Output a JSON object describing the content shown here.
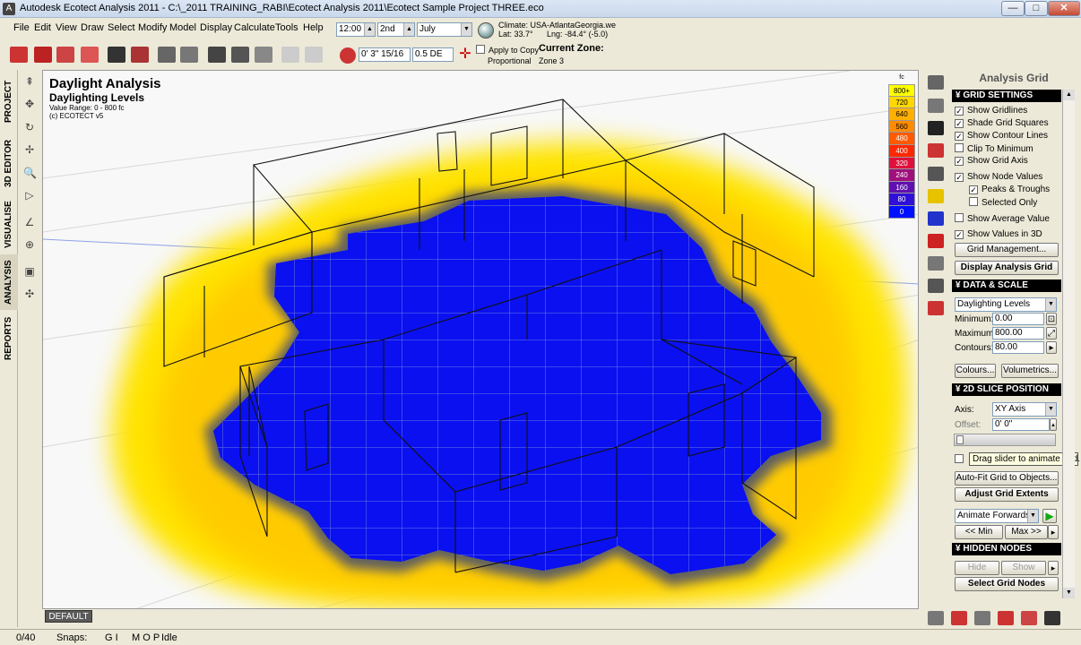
{
  "window": {
    "title": "Autodesk Ecotect Analysis 2011 - C:\\_2011 TRAINING_RABI\\Ecotect Analysis 2011\\Ecotect Sample Project THREE.eco",
    "app_icon": "A",
    "minimize": "—",
    "maximize": "□",
    "close": "✕"
  },
  "menu": [
    "File",
    "Edit",
    "View",
    "Draw",
    "Select",
    "Modify",
    "Model",
    "Display",
    "Calculate",
    "Tools",
    "Help"
  ],
  "timebar": {
    "time": "12:00",
    "day": "2nd",
    "month": "July",
    "climate_label": "Climate: USA-AtlantaGeorgia.we",
    "lat": "Lat: 33.7°",
    "lng": "Lng: -84.4° (-5.0)",
    "offset1": "0' 3\" 15/16",
    "offset2": "0.5 DE",
    "apply_copy": "Apply to Copy",
    "proportional": "Proportional",
    "current_zone_label": "Current Zone:",
    "current_zone_value": "Zone 3"
  },
  "left_tabs": [
    "PROJECT",
    "3D EDITOR",
    "VISUALISE",
    "ANALYSIS",
    "REPORTS"
  ],
  "viewport": {
    "title": "Daylight Analysis",
    "subtitle": "Daylighting Levels",
    "range": "Value Range: 0 - 800 fc",
    "copyright": "(c) ECOTECT v5",
    "layer": "DEFAULT"
  },
  "legend": {
    "unit": "fc",
    "items": [
      {
        "label": "800+",
        "color": "#ffff00"
      },
      {
        "label": "720",
        "color": "#ffd800"
      },
      {
        "label": "640",
        "color": "#ffb000"
      },
      {
        "label": "560",
        "color": "#ff8c00"
      },
      {
        "label": "480",
        "color": "#ff5a00"
      },
      {
        "label": "400",
        "color": "#ff2800"
      },
      {
        "label": "320",
        "color": "#e0103c"
      },
      {
        "label": "240",
        "color": "#a0107c"
      },
      {
        "label": "160",
        "color": "#6010b0"
      },
      {
        "label": "80",
        "color": "#3010d8"
      },
      {
        "label": "0",
        "color": "#0010ff"
      }
    ]
  },
  "panel": {
    "title": "Analysis Grid",
    "grid_settings": {
      "header": "GRID SETTINGS",
      "options": [
        {
          "label": "Show Gridlines",
          "checked": "✓"
        },
        {
          "label": "Shade Grid Squares",
          "checked": "✓"
        },
        {
          "label": "Show Contour Lines",
          "checked": "✓"
        },
        {
          "label": "Clip To Minimum",
          "checked": ""
        },
        {
          "label": "Show Grid Axis",
          "checked": "✓"
        },
        {
          "label": "Show Node Values",
          "checked": "✓"
        },
        {
          "label": "Peaks & Troughs",
          "checked": "✓"
        },
        {
          "label": "Selected Only",
          "checked": ""
        },
        {
          "label": "Show Average Value",
          "checked": ""
        },
        {
          "label": "Show Values in 3D",
          "checked": "✓"
        }
      ],
      "grid_management": "Grid Management...",
      "display_grid": "Display Analysis Grid"
    },
    "data_scale": {
      "header": "DATA & SCALE",
      "data_type": "Daylighting Levels",
      "min_label": "Minimum:",
      "min_value": "0.00",
      "max_label": "Maximum:",
      "max_value": "800.00",
      "contours_label": "Contours:",
      "contours_value": "80.00",
      "colours": "Colours...",
      "volumetrics": "Volumetrics..."
    },
    "slice": {
      "header": "2D SLICE POSITION",
      "axis_label": "Axis:",
      "axis_value": "XY Axis",
      "offset_label": "Offset:",
      "offset_value": "0' 0\"",
      "tooltip": "Drag slider to animate grid.",
      "auto_fit": "Auto-Fit Grid to Objects...",
      "adjust": "Adjust Grid Extents",
      "animate": "Animate Forwards",
      "min": "<< Min",
      "max": "Max >>"
    },
    "hidden_nodes": {
      "header": "HIDDEN NODES",
      "hide": "Hide",
      "show": "Show",
      "select": "Select Grid Nodes"
    }
  },
  "status": {
    "count": "0/40",
    "snaps_label": "Snaps:",
    "snaps1": "G I",
    "snaps2": "M O P",
    "state": "Idle"
  }
}
